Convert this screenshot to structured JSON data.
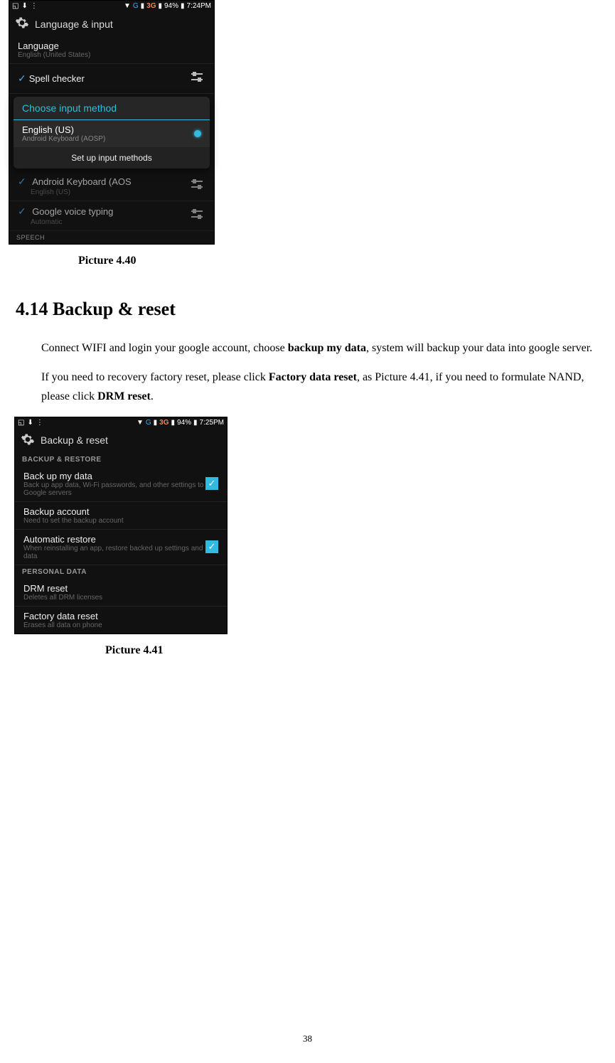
{
  "phone1": {
    "status": {
      "network": "G",
      "threeg": "3G",
      "battery": "94%",
      "time": "7:24PM"
    },
    "header": "Language & input",
    "language": {
      "title": "Language",
      "sub": "English (United States)"
    },
    "spell": "Spell checker",
    "dialog": {
      "title": "Choose input method",
      "option_title": "English (US)",
      "option_sub": "Android Keyboard (AOSP)",
      "button": "Set up input methods"
    },
    "kb": {
      "title": "Android Keyboard (AOS",
      "sub": "English (US)"
    },
    "voice": {
      "title": "Google voice typing",
      "sub": "Automatic"
    },
    "speech": "SPEECH"
  },
  "caption1": "Picture 4.40",
  "heading": "4.14 Backup & reset",
  "para1_a": "Connect WIFI and login your google account, choose ",
  "para1_b": "backup my data",
  "para1_c": ", system will backup your data into google server.",
  "para2_a": "If you need to recovery factory reset, please click ",
  "para2_b": "Factory data reset",
  "para2_c": ", as Picture 4.41, if you need to formulate NAND, please click ",
  "para2_d": "DRM reset",
  "para2_e": ".",
  "phone2": {
    "status": {
      "network": "G",
      "threeg": "3G",
      "battery": "94%",
      "time": "7:25PM"
    },
    "header": "Backup & reset",
    "sec1": "BACKUP & RESTORE",
    "backup": {
      "title": "Back up my data",
      "sub": "Back up app data, Wi-Fi passwords, and other settings to Google servers"
    },
    "account": {
      "title": "Backup account",
      "sub": "Need to set the backup account"
    },
    "restore": {
      "title": "Automatic restore",
      "sub": "When reinstalling an app, restore backed up settings and data"
    },
    "sec2": "PERSONAL DATA",
    "drm": {
      "title": "DRM reset",
      "sub": "Deletes all DRM licenses"
    },
    "factory": {
      "title": "Factory data reset",
      "sub": "Erases all data on phone"
    }
  },
  "caption2": "Picture 4.41",
  "page": "38"
}
